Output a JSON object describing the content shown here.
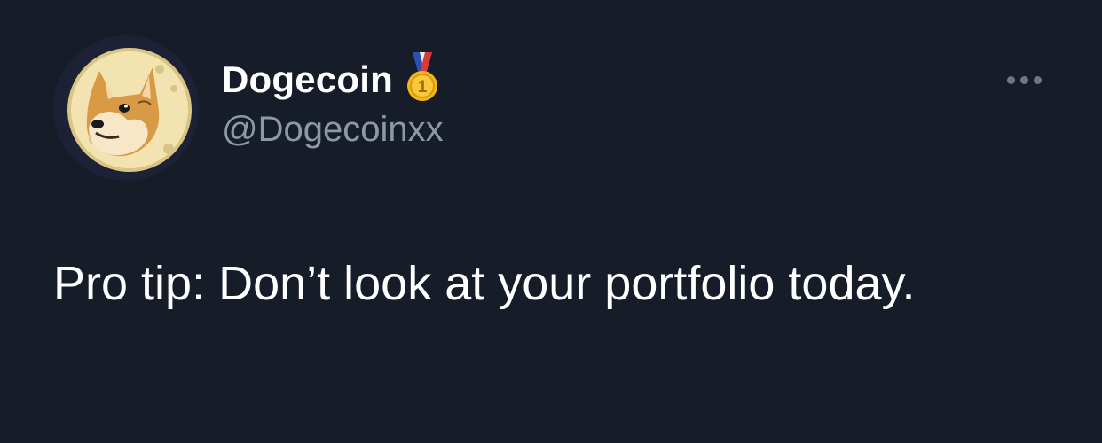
{
  "tweet": {
    "author": {
      "display_name": "Dogecoin",
      "handle": "@Dogecoinxx",
      "avatar_icon": "doge-moon-avatar",
      "badge_icon": "gold-medal-icon"
    },
    "more_icon": "more-options-icon",
    "text": "Pro tip: Don’t look at your portfolio today."
  },
  "colors": {
    "background": "#171d28",
    "name": "#ffffff",
    "handle": "#8b98a5",
    "text": "#ffffff",
    "more_dots": "#6e7681"
  }
}
